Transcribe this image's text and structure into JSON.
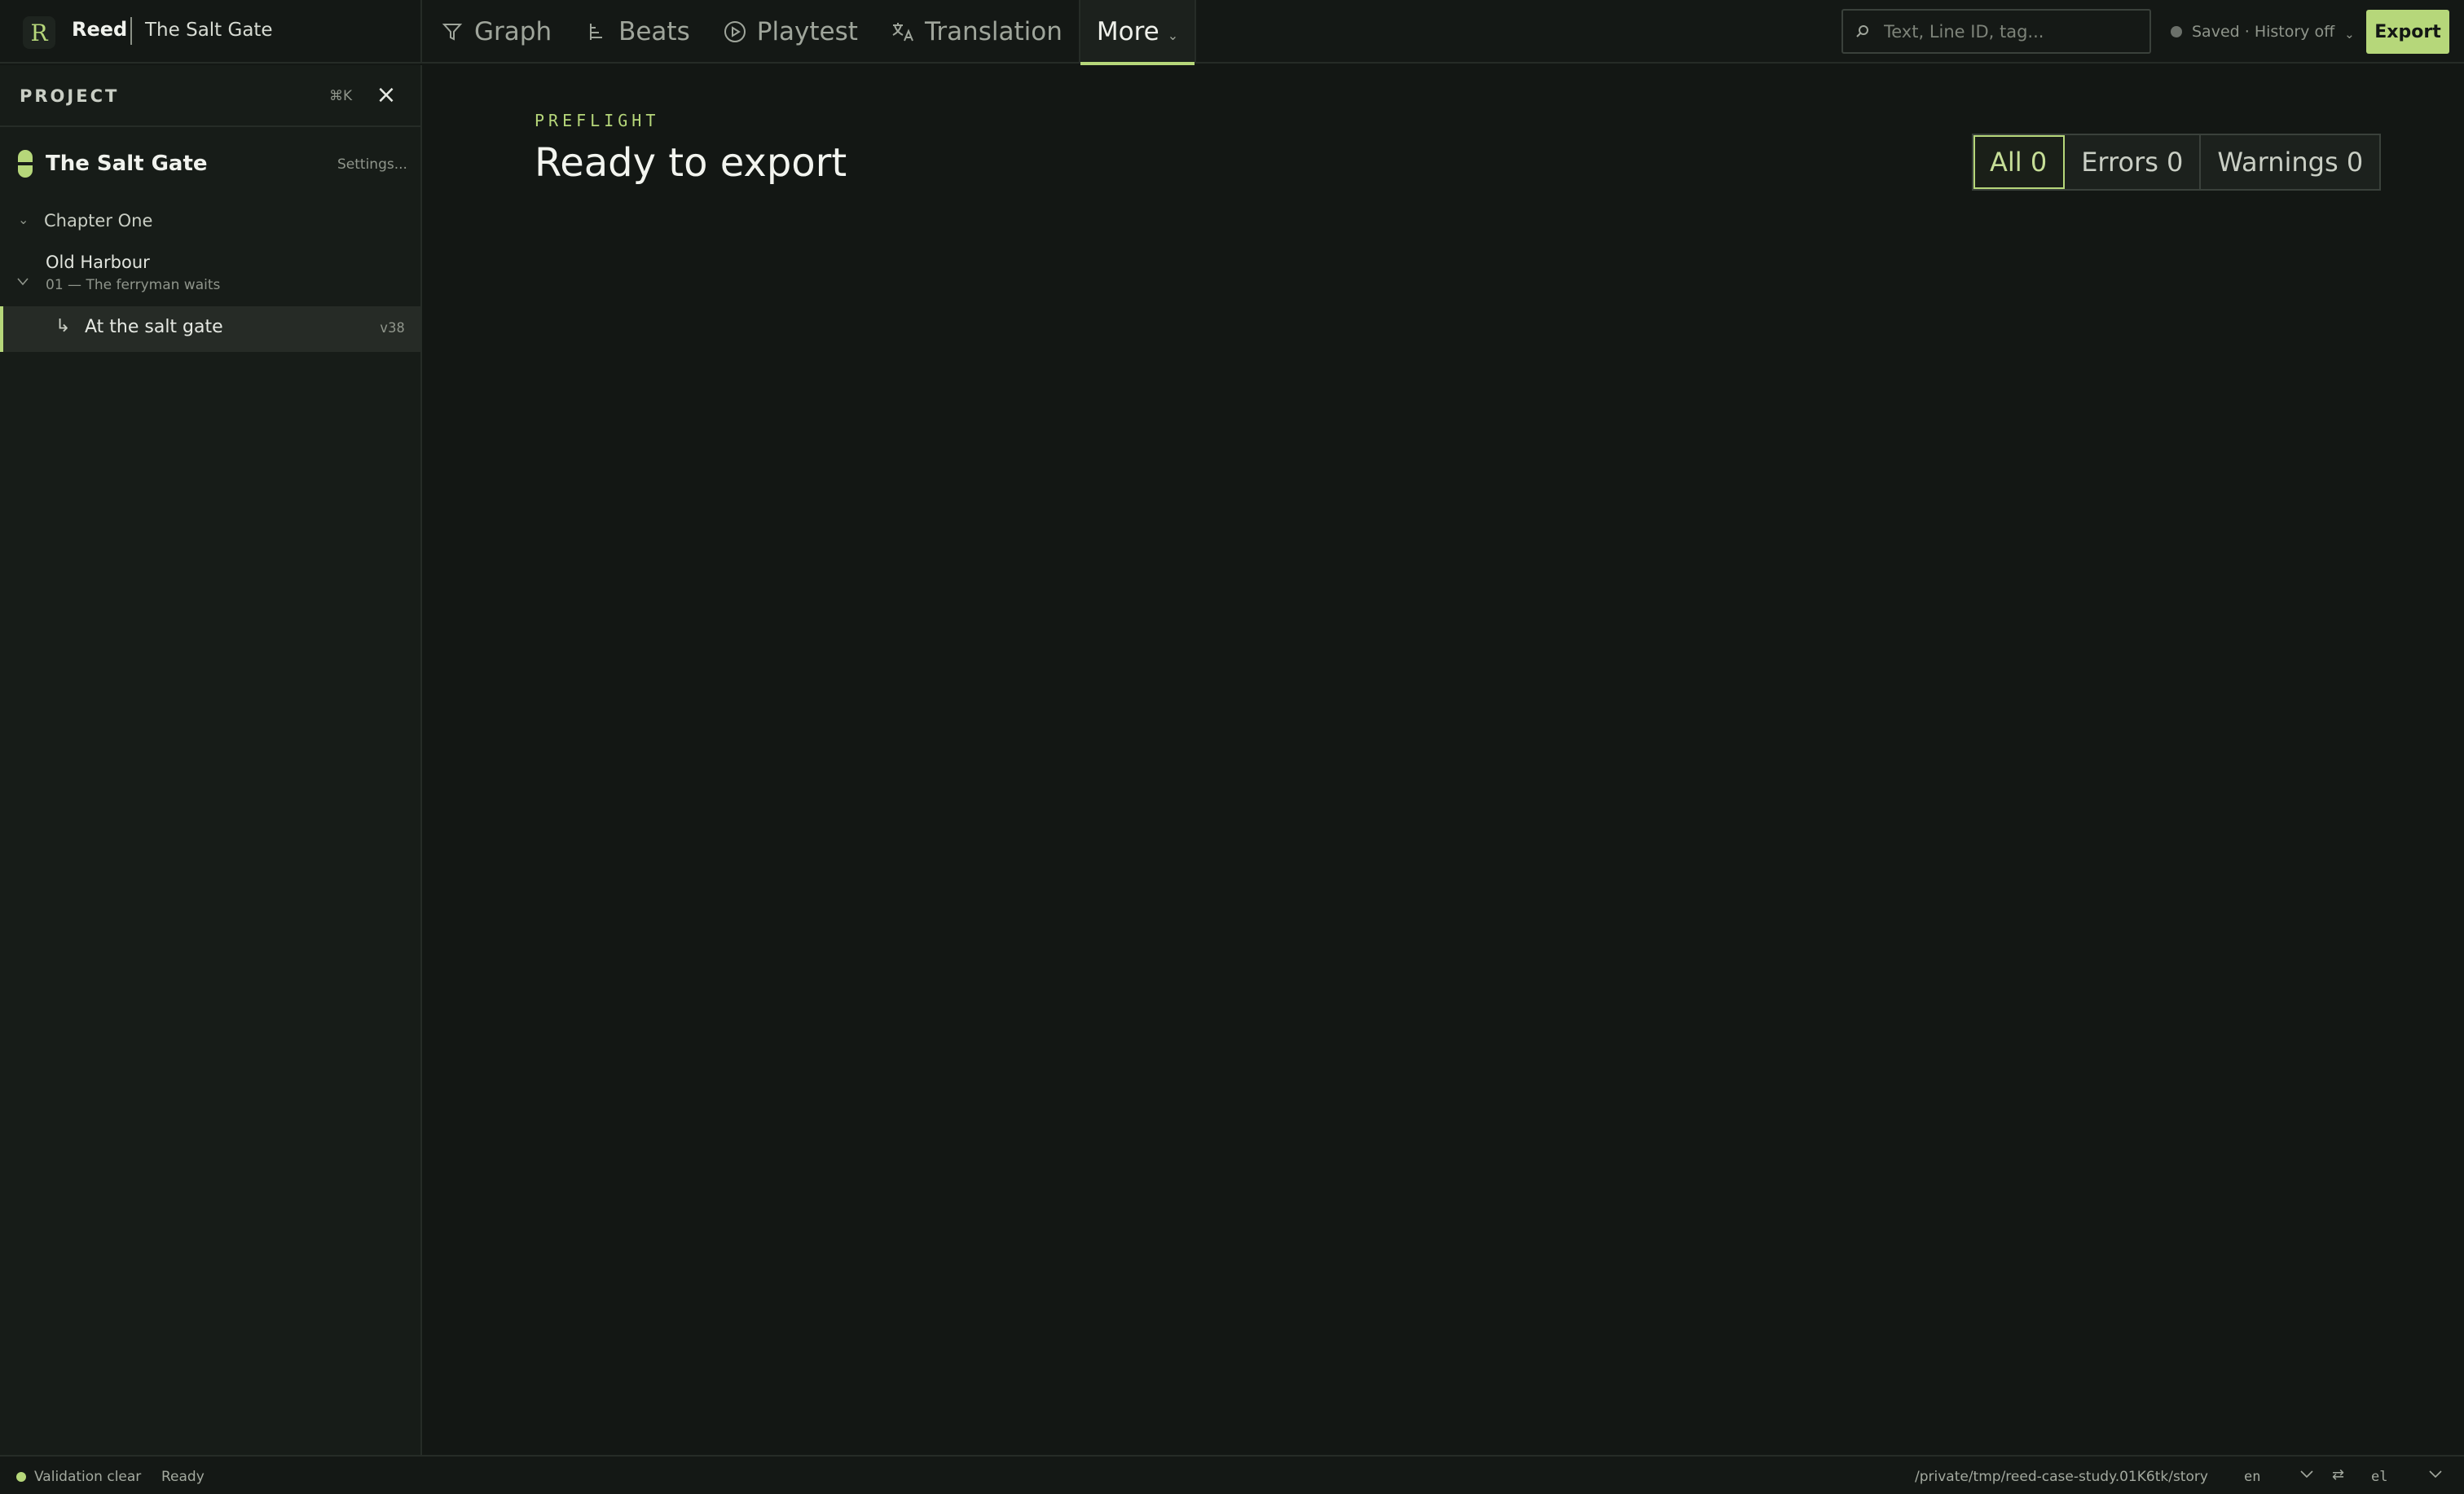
{
  "app": {
    "name": "Reed",
    "logo_glyph": "R",
    "project": "The Salt Gate"
  },
  "nav": {
    "tabs": [
      {
        "label": "Graph",
        "icon": "funnel-icon"
      },
      {
        "label": "Beats",
        "icon": "tree-branch-icon"
      },
      {
        "label": "Playtest",
        "icon": "play-circle-icon"
      },
      {
        "label": "Translation",
        "icon": "translate-icon"
      },
      {
        "label": "More",
        "icon": "chevron-down-icon"
      }
    ]
  },
  "search": {
    "placeholder": "Text, Line ID, tag..."
  },
  "save_status": {
    "text": "Saved · History off"
  },
  "export_label": "Export",
  "sidebar": {
    "title": "PROJECT",
    "shortcut": "⌘K",
    "project_title": "The Salt Gate",
    "settings_label": "Settings...",
    "chapter": "Chapter One",
    "scene": {
      "label": "Old Harbour",
      "sub": "01 — The ferryman waits"
    },
    "node": {
      "label": "At the salt gate",
      "version": "v38"
    }
  },
  "main": {
    "eyebrow": "PREFLIGHT",
    "title": "Ready to export",
    "filters": [
      {
        "label": "All 0",
        "active": true
      },
      {
        "label": "Errors 0",
        "active": false
      },
      {
        "label": "Warnings 0",
        "active": false
      }
    ]
  },
  "statusbar": {
    "validation": "Validation clear",
    "state": "Ready",
    "path": "/private/tmp/reed-case-study.01K6tk/story",
    "source_lang": "en",
    "target_lang": "el"
  },
  "colors": {
    "accent": "#b6d77a",
    "background": "#131714",
    "panel": "#171c18"
  }
}
